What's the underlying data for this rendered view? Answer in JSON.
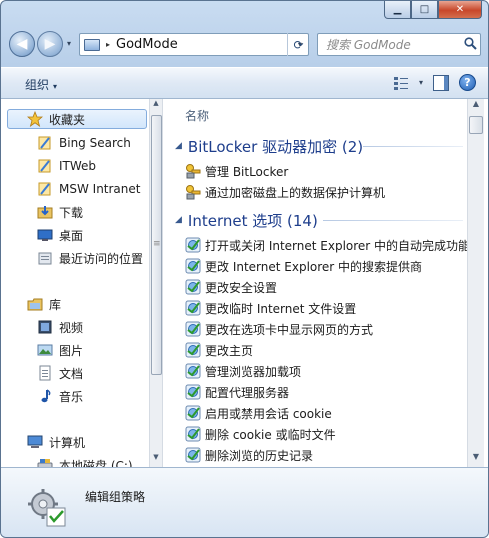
{
  "window": {
    "controls": {
      "minimize": "▁",
      "maximize": "□",
      "close": "✕"
    }
  },
  "address": {
    "path": "GodMode",
    "separator": "▸",
    "dropdown": "▾",
    "refresh": "⟳"
  },
  "search": {
    "placeholder": "搜索 GodMode"
  },
  "nav_buttons": {
    "back": "◀",
    "forward": "▶",
    "dropdown": "▾"
  },
  "toolbar": {
    "organize": "组织",
    "caret": "▾",
    "help": "?"
  },
  "nav_pane": {
    "favorites_header": "收藏夹",
    "favorites": [
      {
        "label": "Bing Search",
        "icon": "favorite-link-icon"
      },
      {
        "label": "ITWeb",
        "icon": "favorite-link-icon"
      },
      {
        "label": "MSW Intranet",
        "icon": "favorite-link-icon"
      },
      {
        "label": "下载",
        "icon": "downloads-folder-icon"
      },
      {
        "label": "桌面",
        "icon": "desktop-icon"
      },
      {
        "label": "最近访问的位置",
        "icon": "recent-places-icon"
      }
    ],
    "libraries_header": "库",
    "libraries": [
      {
        "label": "视频",
        "icon": "videos-icon"
      },
      {
        "label": "图片",
        "icon": "pictures-icon"
      },
      {
        "label": "文档",
        "icon": "documents-icon"
      },
      {
        "label": "音乐",
        "icon": "music-icon"
      }
    ],
    "computer_header": "计算机",
    "computer": [
      {
        "label": "本地磁盘 (C:)",
        "icon": "local-disk-icon"
      }
    ]
  },
  "content": {
    "column_header": "名称",
    "groups": [
      {
        "title": "BitLocker 驱动器加密 (2)",
        "items": [
          "管理 BitLocker",
          "通过加密磁盘上的数据保护计算机"
        ]
      },
      {
        "title": "Internet 选项 (14)",
        "items": [
          "打开或关闭 Internet Explorer 中的自动完成功能",
          "更改 Internet Explorer 中的搜索提供商",
          "更改安全设置",
          "更改临时 Internet 文件设置",
          "更改在选项卡中显示网页的方式",
          "更改主页",
          "管理浏览器加载项",
          "配置代理服务器",
          "启用或禁用会话 cookie",
          "删除 cookie 或临时文件",
          "删除浏览的历史记录"
        ]
      }
    ]
  },
  "details": {
    "name": "编辑组策略"
  },
  "colors": {
    "link_blue": "#1e3e8c",
    "selection": "#d2e6fb",
    "frame": "#b8cfe9"
  }
}
